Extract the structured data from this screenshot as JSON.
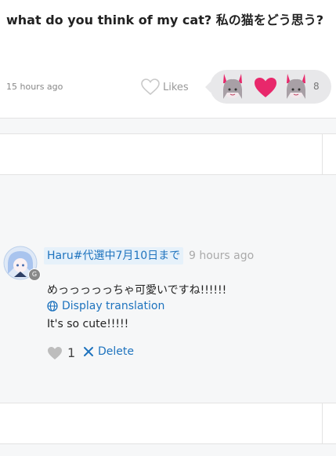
{
  "post": {
    "title": "what do you think of my cat? 私の猫をどう思う?",
    "time": "15 hours ago",
    "likes_label": "Likes",
    "like_count": "8"
  },
  "comment": {
    "author": "Haru#代選中7月10日まで",
    "time": "9 hours ago",
    "text": "めっっっっっちゃ可愛いですね!!!!!!",
    "translate_label": "Display translation",
    "translation": "It's so cute!!!!!",
    "like_count": "1",
    "delete_label": "Delete",
    "badge": "G"
  },
  "colors": {
    "link": "#1e73be",
    "heart": "#e8286b",
    "background": "#f6f7f8"
  }
}
